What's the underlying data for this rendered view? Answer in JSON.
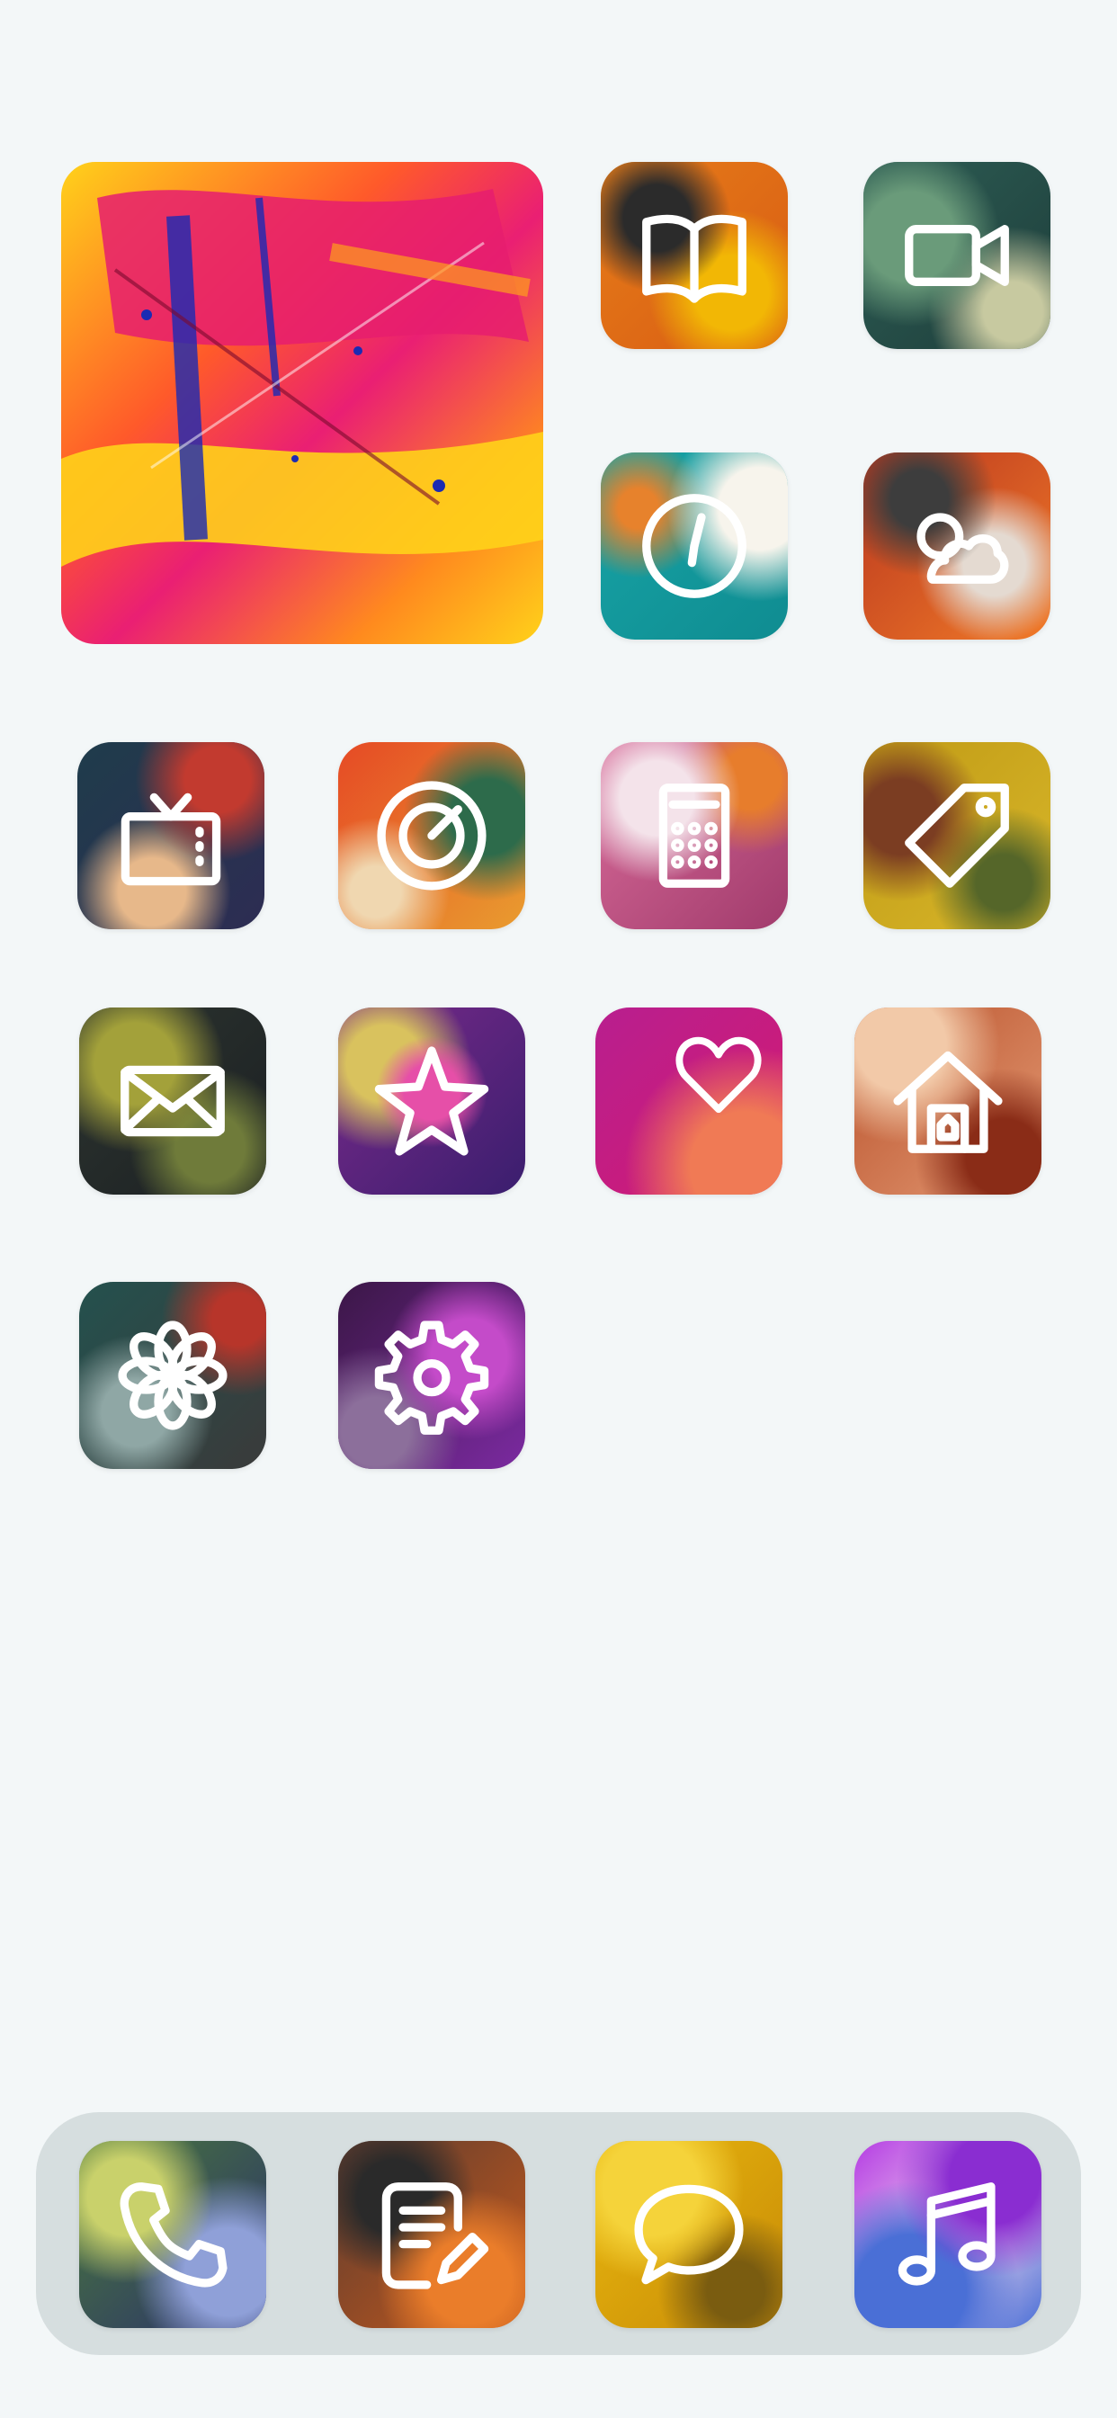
{
  "screen": {
    "background": "#f3f7f8"
  },
  "widget": {
    "name": "abstract-painting-photo-widget",
    "colors": [
      "#ffd21a",
      "#ff8a1e",
      "#ea1f73",
      "#d9146b",
      "#1b2bb3"
    ]
  },
  "home_apps": [
    {
      "icon": "book-icon",
      "colors": [
        "#e67d1a",
        "#2b2b2b",
        "#f2b705",
        "#d85b12"
      ]
    },
    {
      "icon": "video-camera-icon",
      "colors": [
        "#2e5e55",
        "#6a9b7a",
        "#1d3d3a",
        "#c7c9a0"
      ]
    },
    {
      "icon": "clock-icon",
      "colors": [
        "#17a4a6",
        "#f7f4ec",
        "#e7822c",
        "#0f8c91"
      ]
    },
    {
      "icon": "weather-cloud-icon",
      "colors": [
        "#b9361f",
        "#3d3d3d",
        "#e4dad1",
        "#f07a28"
      ]
    },
    {
      "icon": "tv-icon",
      "colors": [
        "#1f3c4b",
        "#c23a2f",
        "#e7b88a",
        "#2d2c53"
      ]
    },
    {
      "icon": "target-icon",
      "colors": [
        "#e64a25",
        "#e99c2f",
        "#2d6b4b",
        "#f0d7b0"
      ]
    },
    {
      "icon": "calculator-icon",
      "colors": [
        "#d96c9a",
        "#e77d2c",
        "#f4e3ea",
        "#a13b6c"
      ]
    },
    {
      "icon": "tag-icon",
      "colors": [
        "#c09a15",
        "#7b3d22",
        "#d8b72a",
        "#556629"
      ]
    },
    {
      "icon": "mail-icon",
      "colors": [
        "#2d3530",
        "#a3a13a",
        "#1b1f22",
        "#6f7b3a"
      ]
    },
    {
      "icon": "star-icon",
      "colors": [
        "#7a2a8a",
        "#e64fa8",
        "#d9c25e",
        "#3a1e6e"
      ]
    },
    {
      "icon": "heart-icon",
      "colors": [
        "#b81f8f",
        "#e4366f",
        "#f07a55",
        "#c81c7d"
      ]
    },
    {
      "icon": "home-icon",
      "colors": [
        "#b8502a",
        "#e49b75",
        "#8a2c17",
        "#f2c9a8"
      ]
    },
    {
      "icon": "flower-icon",
      "colors": [
        "#24514e",
        "#3a3a3a",
        "#b7352a",
        "#8fa7a5"
      ]
    },
    {
      "icon": "gear-icon",
      "colors": [
        "#7b2aa0",
        "#c44bc9",
        "#3b1747",
        "#8c6f9b"
      ]
    }
  ],
  "dock_apps": [
    {
      "icon": "phone-icon",
      "colors": [
        "#4a7a3b",
        "#2a2f6b",
        "#c9d16b",
        "#8fa0d8"
      ]
    },
    {
      "icon": "notes-icon",
      "colors": [
        "#5b3b30",
        "#c75a1c",
        "#2a2a2a",
        "#ea7d2a"
      ]
    },
    {
      "icon": "messages-icon",
      "colors": [
        "#e9b80f",
        "#c78a06",
        "#f5d33a",
        "#7a5c10"
      ]
    },
    {
      "icon": "music-icon",
      "colors": [
        "#b43ce3",
        "#4a6fd6",
        "#f0d7ef",
        "#8a2dd1"
      ]
    }
  ]
}
